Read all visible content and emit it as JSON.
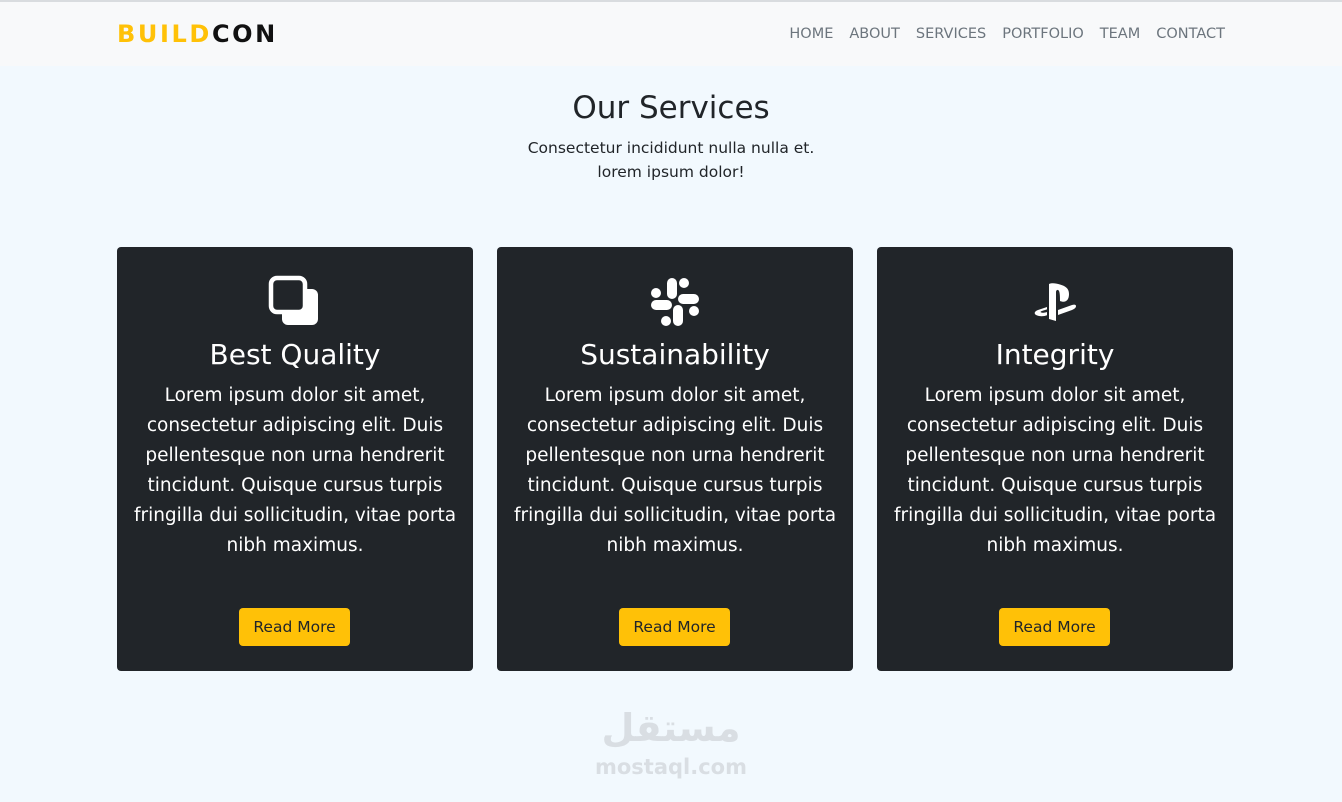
{
  "brand": {
    "part1": "BUILD",
    "part2": "CON"
  },
  "nav": {
    "items": [
      "HOME",
      "ABOUT",
      "SERVICES",
      "PORTFOLIO",
      "TEAM",
      "CONTACT"
    ]
  },
  "services": {
    "title": "Our Services",
    "subtitle": "Consectetur incididunt nulla nulla et. lorem ipsum dolor!",
    "cards": [
      {
        "icon": "overlapping-squares-icon",
        "title": "Best Quality",
        "text": "Lorem ipsum dolor sit amet, consectetur adipiscing elit. Duis pellentesque non urna hendrerit tincidunt. Quisque cursus turpis fringilla dui sollicitudin, vitae porta nibh maximus.",
        "button": "Read More"
      },
      {
        "icon": "slack-icon",
        "title": "Sustainability",
        "text": "Lorem ipsum dolor sit amet, consectetur adipiscing elit. Duis pellentesque non urna hendrerit tincidunt. Quisque cursus turpis fringilla dui sollicitudin, vitae porta nibh maximus.",
        "button": "Read More"
      },
      {
        "icon": "playstation-icon",
        "title": "Integrity",
        "text": "Lorem ipsum dolor sit amet, consectetur adipiscing elit. Duis pellentesque non urna hendrerit tincidunt. Quisque cursus turpis fringilla dui sollicitudin, vitae porta nibh maximus.",
        "button": "Read More"
      }
    ]
  },
  "watermark": {
    "logo": "مستقل",
    "url": "mostaql.com"
  },
  "colors": {
    "accent": "#ffc107",
    "card_bg": "#212529",
    "page_bg": "#f2f9fe",
    "nav_text": "#6c757d"
  }
}
